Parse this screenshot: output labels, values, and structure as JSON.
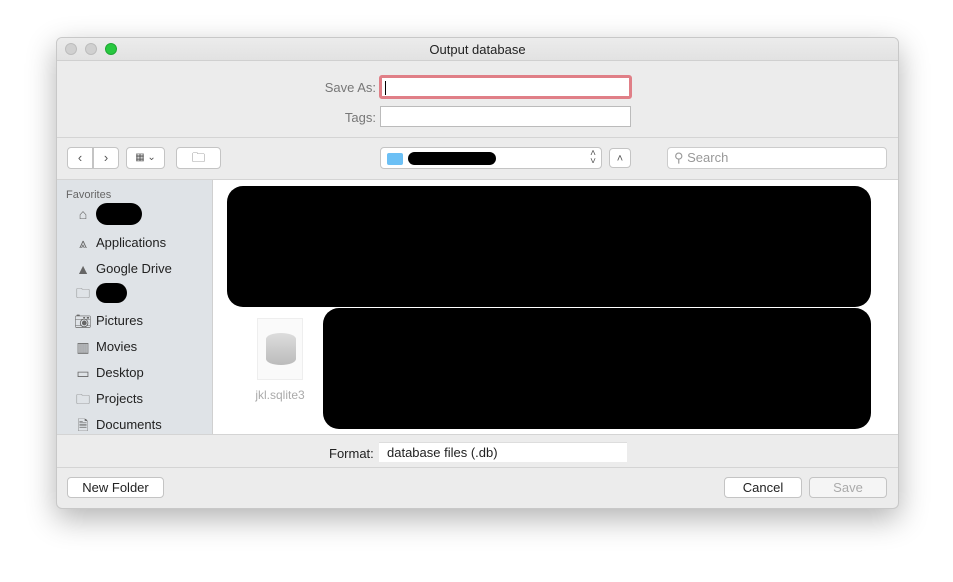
{
  "window": {
    "title": "Output database"
  },
  "form": {
    "save_as_label": "Save As:",
    "save_as_value": "",
    "tags_label": "Tags:",
    "tags_value": ""
  },
  "toolbar": {
    "back_icon": "chevron-left-icon",
    "forward_icon": "chevron-right-icon",
    "view_icon": "grid-view-icon",
    "new_folder_icon": "new-folder-icon",
    "search_placeholder": "Search"
  },
  "sidebar": {
    "section": "Favorites",
    "items": [
      {
        "label": "",
        "icon": "home-icon"
      },
      {
        "label": "Applications",
        "icon": "applications-icon"
      },
      {
        "label": "Google Drive",
        "icon": "google-drive-icon"
      },
      {
        "label": "",
        "icon": "folder-icon"
      },
      {
        "label": "Pictures",
        "icon": "camera-icon"
      },
      {
        "label": "Movies",
        "icon": "film-icon"
      },
      {
        "label": "Desktop",
        "icon": "desktop-icon"
      },
      {
        "label": "Projects",
        "icon": "folder-icon"
      },
      {
        "label": "Documents",
        "icon": "documents-icon"
      }
    ]
  },
  "files": [
    {
      "name": "jkl.sqlite3",
      "icon": "database-file-icon"
    }
  ],
  "format": {
    "label": "Format:",
    "value": "database files (.db)"
  },
  "buttons": {
    "new_folder": "New Folder",
    "cancel": "Cancel",
    "save": "Save"
  },
  "colors": {
    "focus_ring": "#e07f87",
    "close": "#d0d0d0",
    "zoom": "#28c840",
    "folder": "#6cc0f5"
  }
}
